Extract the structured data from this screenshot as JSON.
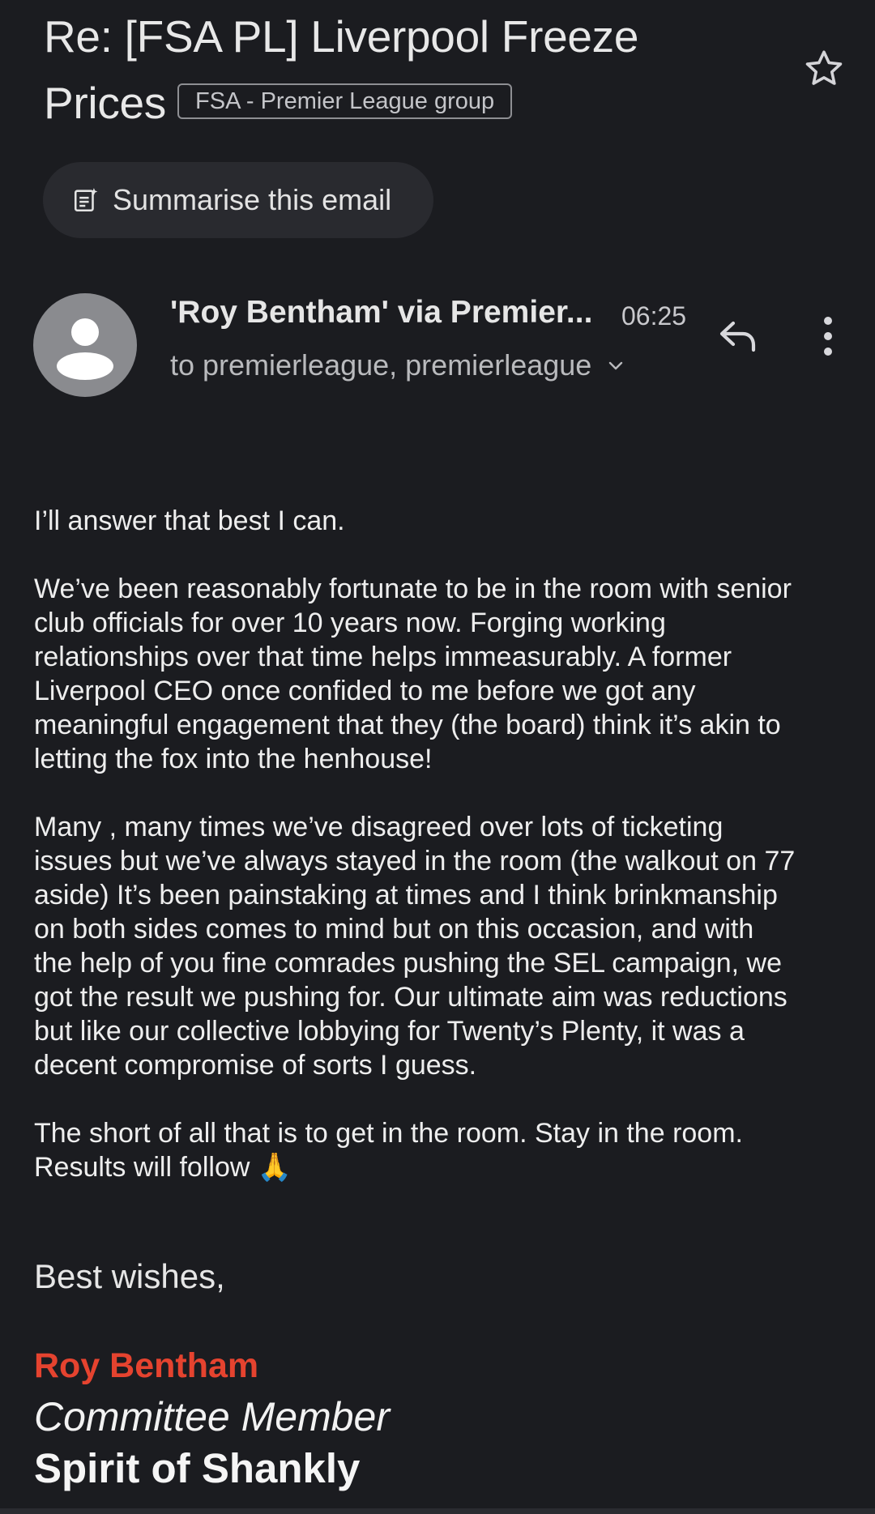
{
  "subject": {
    "line1": "Re: [FSA PL] Liverpool Freeze",
    "line2": "Prices",
    "label": "FSA - Premier League group"
  },
  "icons": {
    "star": "star-outline-icon",
    "summarise": "summary-sparkle-icon",
    "avatar": "person-icon",
    "reply": "reply-arrow-icon",
    "more": "vertical-dots-icon",
    "expand": "chevron-down-icon"
  },
  "summarise_button": {
    "label": "Summarise this email"
  },
  "message": {
    "sender": "'Roy Bentham' via Premier...",
    "time": "06:25",
    "recipients": "to premierleague, premierleague"
  },
  "body": {
    "p1": "I’ll answer that best I can.",
    "p2": "We’ve been reasonably fortunate to be in the room with senior\nclub officials for over 10 years now. Forging working\nrelationships over that time helps immeasurably. A former\nLiverpool CEO once confided to me before we got any\nmeaningful engagement that they (the board) think it’s akin to\nletting the fox into the henhouse!",
    "p3": "Many , many times we’ve disagreed over lots of ticketing\nissues but we’ve always stayed in the room (the walkout on 77\naside) It’s been painstaking at times and I think brinkmanship\non both sides comes to mind but on this occasion, and with\nthe help of you fine comrades pushing the SEL campaign, we\ngot the result we pushing for. Our ultimate aim was reductions\nbut like our collective lobbying for Twenty’s Plenty,  it was a\ndecent compromise of sorts I guess.",
    "p4": "The short of all that is to get in the room. Stay in the room.\nResults will follow 🙏"
  },
  "signature": {
    "signoff": "Best wishes,",
    "name": "Roy Bentham",
    "role": "Committee Member",
    "org": "Spirit of Shankly"
  },
  "colors": {
    "background": "#1b1c20",
    "chip": "#292a2f",
    "signature_name": "#e5432f"
  }
}
